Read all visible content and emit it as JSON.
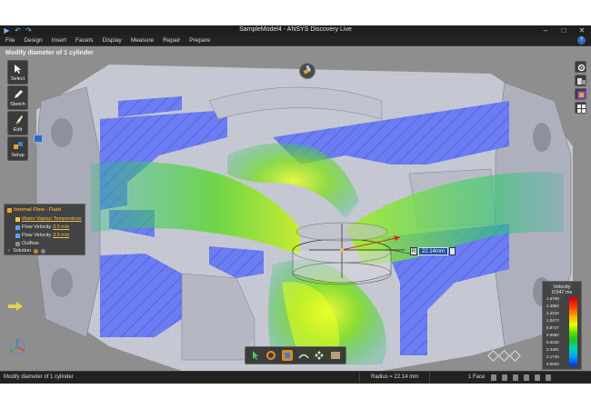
{
  "window": {
    "title": "SampleModel4 - ANSYS Discovery Live"
  },
  "menu": [
    "File",
    "Design",
    "Insert",
    "Facets",
    "Display",
    "Measure",
    "Repair",
    "Prepare"
  ],
  "tool_caption": "Modify diameter of 1 cylinder",
  "left_toolbar": [
    {
      "label": "Select",
      "icon": "cursor-arrow-icon"
    },
    {
      "label": "Sketch",
      "icon": "pencil-icon"
    },
    {
      "label": "Edit",
      "icon": "brush-edit-icon"
    },
    {
      "label": "Setup",
      "icon": "cubes-setup-icon"
    }
  ],
  "study_tree": {
    "title": "Internal Flow - Fluid",
    "items": [
      {
        "label": "Water Vapour Temperature",
        "link": true,
        "color": "#f2c24a"
      },
      {
        "label": "Flow Velocity",
        "value": "3.5 m/s",
        "color": "#5aa0ff"
      },
      {
        "label": "Flow Velocity",
        "value": "3.5 m/s",
        "color": "#5aa0ff"
      },
      {
        "label": "Outflow",
        "value": "",
        "color": "#8a8a8a"
      }
    ],
    "solution_label": "Solution"
  },
  "measurement": {
    "prefix": "R",
    "value": "22.14mm"
  },
  "legend": {
    "title": "Velocity",
    "max_label": "0.547 ms",
    "ticks": [
      "1.5709",
      "1.3964",
      "1.2218",
      "1.0473",
      "0.8727",
      "0.6982",
      "0.5236",
      "0.3491",
      "0.1745",
      "0.0000"
    ]
  },
  "status": {
    "message": "Modify diameter of 1 cylinder",
    "radius": "Radius = 22.14 mm",
    "selection": "1 Face"
  },
  "colors": {
    "fluid_cut": "#6c7cf2",
    "solid_body": "#c9ccd6",
    "accent": "#2f6fbf"
  }
}
